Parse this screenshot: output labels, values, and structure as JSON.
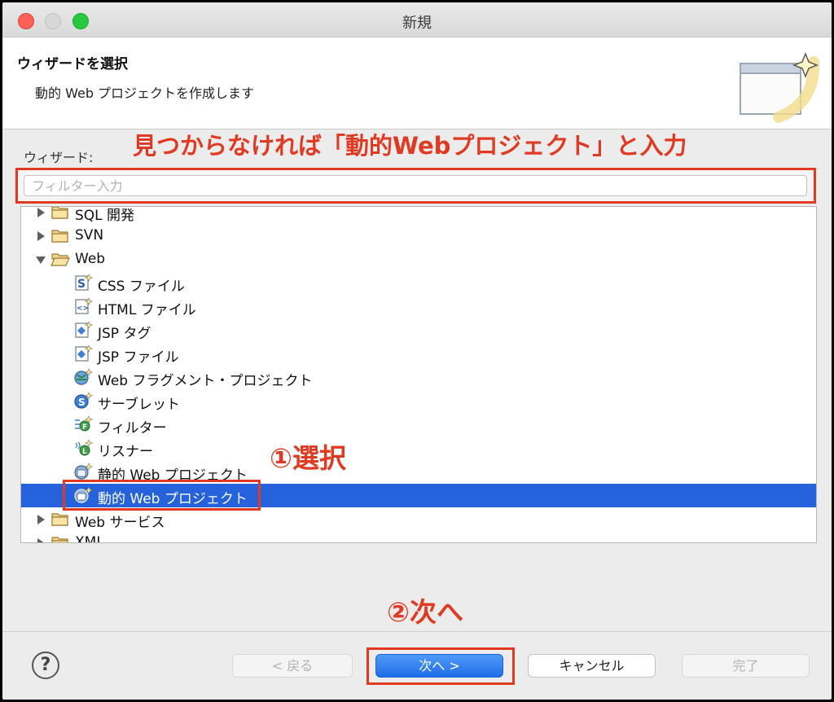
{
  "window": {
    "title": "新規"
  },
  "header": {
    "title": "ウィザードを選択",
    "description": "動的 Web プロジェクトを作成します"
  },
  "wizard_label": "ウィザード:",
  "filter": {
    "placeholder": "フィルター入力",
    "value": ""
  },
  "tree": {
    "items": [
      {
        "label": "SQL 開発",
        "icon": "folder-icon",
        "expandable": true,
        "expanded": false
      },
      {
        "label": "SVN",
        "icon": "folder-icon",
        "expandable": true,
        "expanded": false
      },
      {
        "label": "Web",
        "icon": "folder-open-icon",
        "expandable": true,
        "expanded": true
      },
      {
        "label": "CSS ファイル",
        "icon": "css-file-icon"
      },
      {
        "label": "HTML ファイル",
        "icon": "html-file-icon"
      },
      {
        "label": "JSP タグ",
        "icon": "jsp-tag-icon"
      },
      {
        "label": "JSP ファイル",
        "icon": "jsp-file-icon"
      },
      {
        "label": "Web フラグメント・プロジェクト",
        "icon": "web-fragment-project-icon"
      },
      {
        "label": "サーブレット",
        "icon": "servlet-icon"
      },
      {
        "label": "フィルター",
        "icon": "filter-icon"
      },
      {
        "label": "リスナー",
        "icon": "listener-icon"
      },
      {
        "label": "静的 Web プロジェクト",
        "icon": "static-web-project-icon"
      },
      {
        "label": "動的 Web プロジェクト",
        "icon": "dynamic-web-project-icon",
        "selected": true
      },
      {
        "label": "Web サービス",
        "icon": "folder-icon",
        "expandable": true,
        "expanded": false
      },
      {
        "label": "XML",
        "icon": "folder-icon",
        "expandable": true,
        "expanded": false
      }
    ]
  },
  "annotations": {
    "filter_hint": "見つからなければ「動的Webプロジェクト」と入力",
    "step1": "①選択",
    "step2": "②次へ"
  },
  "buttons": {
    "help": "?",
    "back": "< 戻る",
    "next": "次へ >",
    "cancel": "キャンセル",
    "finish": "完了"
  },
  "colors": {
    "selection": "#2562db",
    "annotation": "#e03a22",
    "primary_button": "#1f6ee8"
  }
}
